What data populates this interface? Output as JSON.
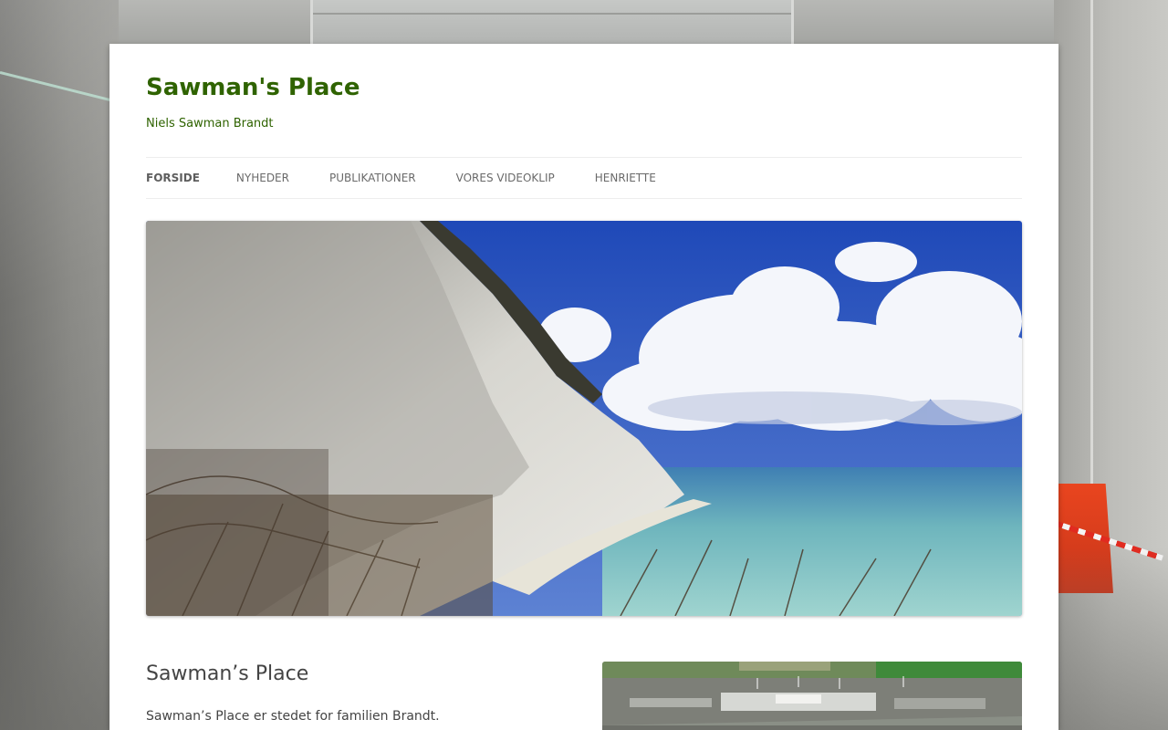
{
  "site": {
    "title": "Sawman's Place",
    "description": "Niels Sawman Brandt"
  },
  "nav": {
    "items": [
      {
        "label": "FORSIDE",
        "active": true
      },
      {
        "label": "NYHEDER",
        "active": false
      },
      {
        "label": "PUBLIKATIONER",
        "active": false
      },
      {
        "label": "VORES VIDEOKLIP",
        "active": false
      },
      {
        "label": "HENRIETTE",
        "active": false
      }
    ]
  },
  "header_image": {
    "subject": "white chalk cliffs above turquoise sea with cumulus clouds"
  },
  "entry": {
    "title": "Sawman’s Place",
    "text": "Sawman’s Place er stedet for familien Brandt."
  },
  "side_image": {
    "subject": "aerial view of construction site and fields"
  },
  "colors": {
    "accent": "#2f6300",
    "text": "#444444",
    "nav_text": "#6a6a6a"
  }
}
